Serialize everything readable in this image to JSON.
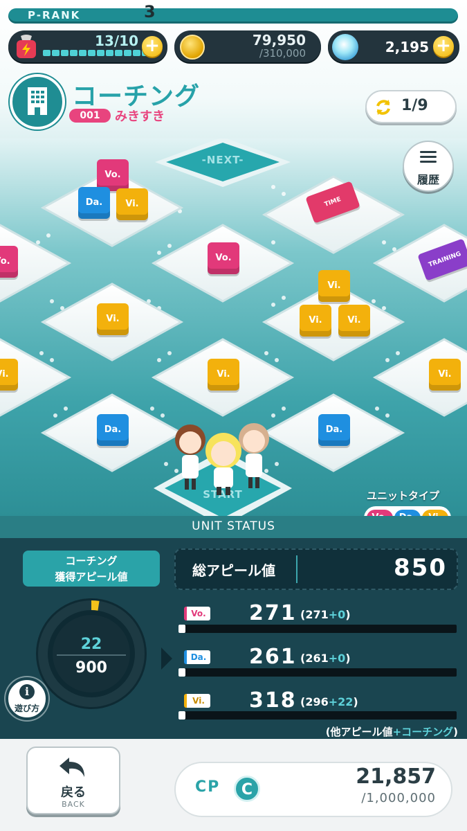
{
  "header": {
    "prank_label": "P-RANK",
    "prank_value": "3",
    "stamina": {
      "text": "13/10",
      "segments": 12
    },
    "coins": {
      "value": "79,950",
      "max": "/310,000"
    },
    "gems": {
      "value": "2,195"
    }
  },
  "title": {
    "main": "コーチング",
    "course_id": "001",
    "course_name": "みきすき",
    "page_counter": "1/9",
    "icon": "building-icon"
  },
  "board": {
    "next_label": "-NEXT-",
    "start_label": "START",
    "history_label": "履歴",
    "ticket_time": "TIME",
    "ticket_training": "TRAINING",
    "cubes": {
      "vo": "Vo.",
      "da": "Da.",
      "vi": "Vi."
    }
  },
  "unit_type": {
    "label": "ユニットタイプ",
    "chips": [
      "Vo.",
      "Da.",
      "Vi."
    ]
  },
  "status": {
    "title": "UNIT STATUS",
    "coaching_label_1": "コーチング",
    "coaching_label_2": "獲得アピール値",
    "gauge_current": "22",
    "gauge_max": "900",
    "gauge_fraction": 0.024,
    "howto_label": "遊び方",
    "total_label": "総アピール値",
    "total_value": "850",
    "stats": [
      {
        "tag": "Vo.",
        "value": "271",
        "base": "(271",
        "plus": "+0",
        "close": ")",
        "fill": 0.02
      },
      {
        "tag": "Da.",
        "value": "261",
        "base": "(261",
        "plus": "+0",
        "close": ")",
        "fill": 0.02
      },
      {
        "tag": "Vi.",
        "value": "318",
        "base": "(296",
        "plus": "+22",
        "close": ")",
        "fill": 0.02
      }
    ],
    "footnote_base": "(他アピール値",
    "footnote_plus": "+コーチング",
    "footnote_close": ")"
  },
  "bottom": {
    "back_label": "戻る",
    "back_sub": "BACK",
    "cp_label": "CP",
    "cp_icon": "C",
    "cp_value": "21,857",
    "cp_max": "/1,000,000"
  },
  "colors": {
    "teal": "#2aa3a8",
    "vo": "#e2397a",
    "da": "#1f8fe0",
    "vi": "#f3b10c"
  }
}
